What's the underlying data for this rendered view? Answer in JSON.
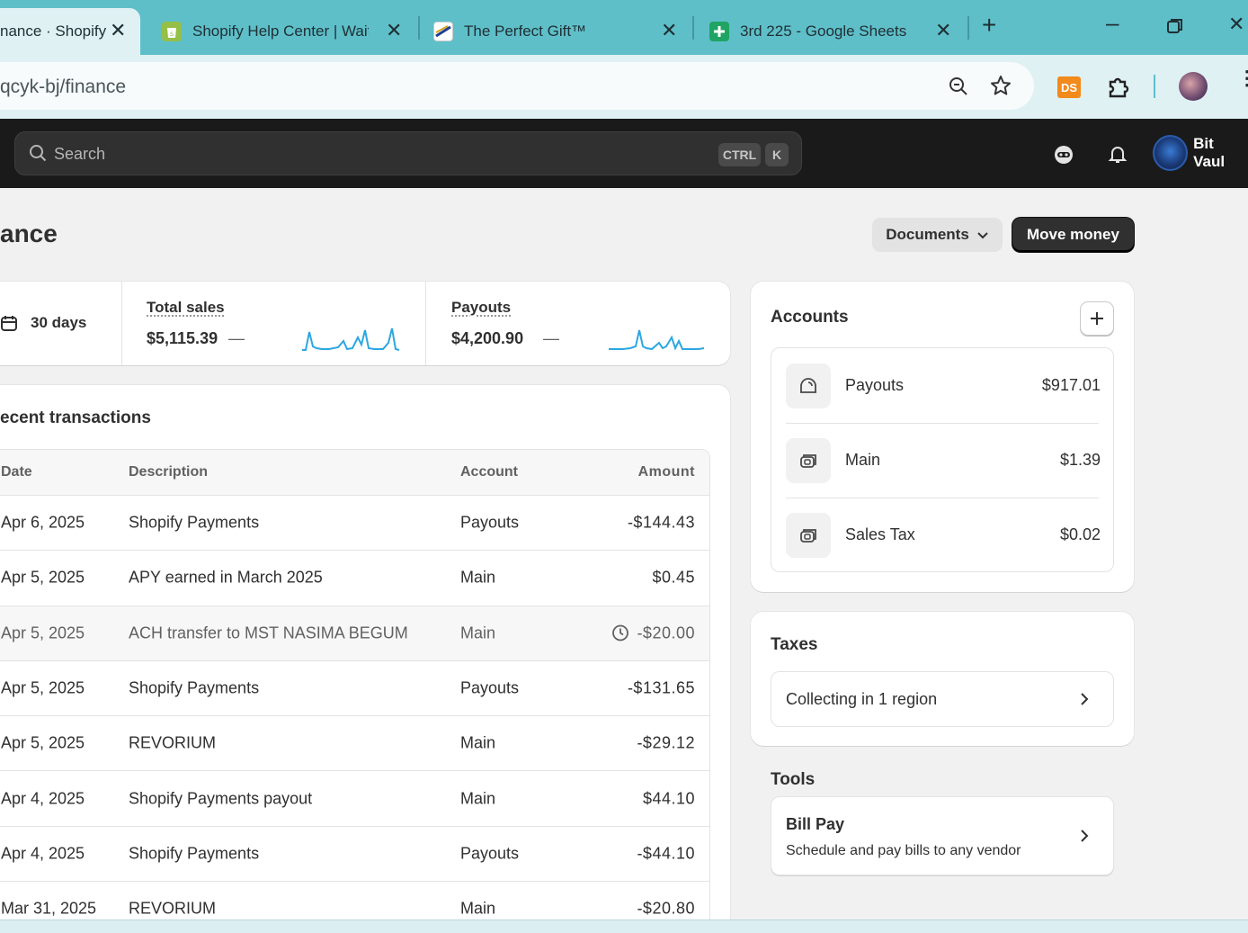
{
  "browser": {
    "tabs": [
      {
        "title": "nance · Shopify",
        "active": true
      },
      {
        "title": "Shopify Help Center | Waiti",
        "active": false
      },
      {
        "title": "The Perfect Gift™",
        "active": false
      },
      {
        "title": "3rd 225 - Google Sheets",
        "active": false
      }
    ],
    "url": "qcyk-bj/finance",
    "extension_label": "DS"
  },
  "topbar": {
    "search_placeholder": "Search",
    "shortcut_ctrl": "CTRL",
    "shortcut_k": "K",
    "store_name": "Bit Vaul"
  },
  "page": {
    "title": "ance",
    "documents_label": "Documents",
    "move_money_label": "Move money"
  },
  "metrics": {
    "period": "30 days",
    "total_sales_label": "Total sales",
    "total_sales_value": "$5,115.39",
    "total_sales_change": "—",
    "payouts_label": "Payouts",
    "payouts_value": "$4,200.90",
    "payouts_change": "—"
  },
  "transactions": {
    "title": "ecent transactions",
    "headers": {
      "date": "Date",
      "description": "Description",
      "account": "Account",
      "amount": "Amount"
    },
    "rows": [
      {
        "date": "Apr 6, 2025",
        "description": "Shopify Payments",
        "account": "Payouts",
        "amount": "-$144.43",
        "pending": false
      },
      {
        "date": "Apr 5, 2025",
        "description": "APY earned in March 2025",
        "account": "Main",
        "amount": "$0.45",
        "pending": false
      },
      {
        "date": "Apr 5, 2025",
        "description": "ACH transfer to MST NASIMA BEGUM",
        "account": "Main",
        "amount": "-$20.00",
        "pending": true
      },
      {
        "date": "Apr 5, 2025",
        "description": "Shopify Payments",
        "account": "Payouts",
        "amount": "-$131.65",
        "pending": false
      },
      {
        "date": "Apr 5, 2025",
        "description": "REVORIUM",
        "account": "Main",
        "amount": "-$29.12",
        "pending": false
      },
      {
        "date": "Apr 4, 2025",
        "description": "Shopify Payments payout",
        "account": "Main",
        "amount": "$44.10",
        "pending": false
      },
      {
        "date": "Apr 4, 2025",
        "description": "Shopify Payments",
        "account": "Payouts",
        "amount": "-$44.10",
        "pending": false
      },
      {
        "date": "Mar 31, 2025",
        "description": "REVORIUM",
        "account": "Main",
        "amount": "-$20.80",
        "pending": false
      }
    ]
  },
  "accounts": {
    "title": "Accounts",
    "items": [
      {
        "name": "Payouts",
        "amount": "$917.01",
        "icon": "payout-icon"
      },
      {
        "name": "Main",
        "amount": "$1.39",
        "icon": "wallet-icon"
      },
      {
        "name": "Sales Tax",
        "amount": "$0.02",
        "icon": "wallet-icon"
      }
    ]
  },
  "taxes": {
    "title": "Taxes",
    "collecting": "Collecting in 1 region"
  },
  "tools": {
    "title": "Tools",
    "bill_pay_title": "Bill Pay",
    "bill_pay_desc": "Schedule and pay bills to any vendor"
  },
  "colors": {
    "tabbar": "#5ebfc9",
    "topbar": "#1a1a1a",
    "sparkline": "#2ba7e0",
    "primary_button": "#303030"
  }
}
